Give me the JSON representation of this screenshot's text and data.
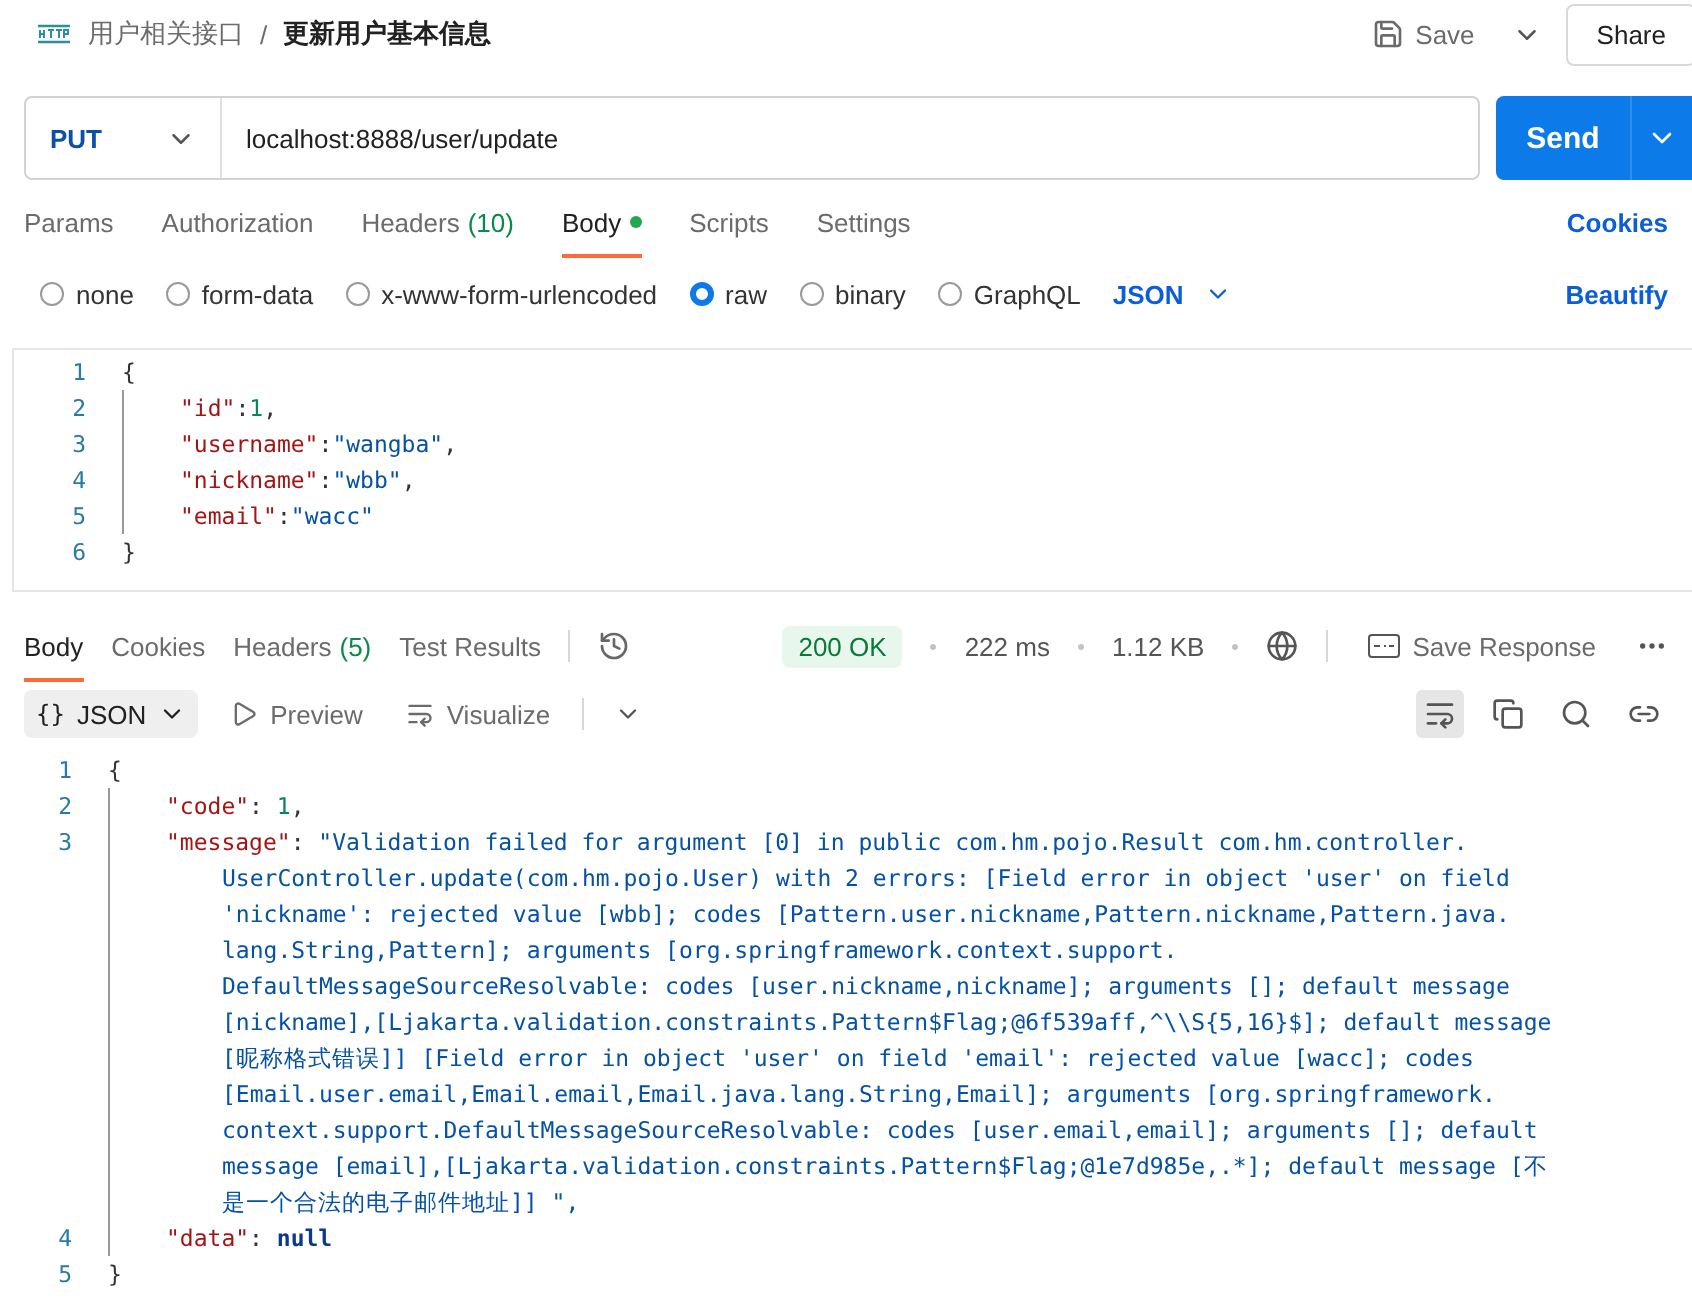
{
  "header": {
    "parent": "用户相关接口",
    "separator": "/",
    "title": "更新用户基本信息",
    "save": "Save",
    "share": "Share"
  },
  "request": {
    "method": "PUT",
    "url": "localhost:8888/user/update",
    "send": "Send"
  },
  "request_tabs": [
    {
      "label": "Params",
      "selected": false
    },
    {
      "label": "Authorization",
      "selected": false
    },
    {
      "label": "Headers",
      "count": "(10)",
      "selected": false
    },
    {
      "label": "Body",
      "selected": true,
      "modified": true
    },
    {
      "label": "Scripts",
      "selected": false
    },
    {
      "label": "Settings",
      "selected": false
    }
  ],
  "cookies_link": "Cookies",
  "body_types": [
    {
      "label": "none",
      "selected": false
    },
    {
      "label": "form-data",
      "selected": false
    },
    {
      "label": "x-www-form-urlencoded",
      "selected": false
    },
    {
      "label": "raw",
      "selected": true
    },
    {
      "label": "binary",
      "selected": false
    },
    {
      "label": "GraphQL",
      "selected": false
    }
  ],
  "body_format": "JSON",
  "beautify": "Beautify",
  "request_body": [
    {
      "number": "1",
      "tokens": [
        {
          "kind": "punct",
          "text": "{"
        }
      ],
      "children": [
        {
          "number": "2",
          "tokens": [
            {
              "kind": "key",
              "text": "\"id\""
            },
            {
              "kind": "punct",
              "text": ":"
            },
            {
              "kind": "num",
              "text": "1"
            },
            {
              "kind": "punct",
              "text": ","
            }
          ]
        },
        {
          "number": "3",
          "tokens": [
            {
              "kind": "key",
              "text": "\"username\""
            },
            {
              "kind": "punct",
              "text": ":"
            },
            {
              "kind": "str",
              "text": "\"wangba\""
            },
            {
              "kind": "punct",
              "text": ","
            }
          ]
        },
        {
          "number": "4",
          "tokens": [
            {
              "kind": "key",
              "text": "\"nickname\""
            },
            {
              "kind": "punct",
              "text": ":"
            },
            {
              "kind": "str",
              "text": "\"wbb\""
            },
            {
              "kind": "punct",
              "text": ","
            }
          ]
        },
        {
          "number": "5",
          "tokens": [
            {
              "kind": "key",
              "text": "\"email\""
            },
            {
              "kind": "punct",
              "text": ":"
            },
            {
              "kind": "str",
              "text": "\"wacc\""
            }
          ]
        }
      ]
    },
    {
      "number": "6",
      "tokens": [
        {
          "kind": "punct",
          "text": "}"
        }
      ]
    }
  ],
  "response_tabs": [
    {
      "label": "Body",
      "selected": true
    },
    {
      "label": "Cookies",
      "selected": false
    },
    {
      "label": "Headers",
      "count": "(5)",
      "selected": false
    },
    {
      "label": "Test Results",
      "selected": false
    }
  ],
  "status": {
    "code": "200 OK",
    "time": "222 ms",
    "size": "1.12 KB",
    "save_response": "Save Response"
  },
  "view": {
    "format_icon": "{}",
    "format": "JSON",
    "preview": "Preview",
    "visualize": "Visualize",
    "wrap_on": true
  },
  "response_body": [
    {
      "number": "1",
      "tokens": [
        {
          "kind": "punct",
          "text": "{"
        }
      ],
      "children": [
        {
          "number": "2",
          "tokens": [
            {
              "kind": "key",
              "text": "\"code\""
            },
            {
              "kind": "punct",
              "text": ": "
            },
            {
              "kind": "num",
              "text": "1"
            },
            {
              "kind": "punct",
              "text": ","
            }
          ]
        },
        {
          "number": "3",
          "tokens": [
            {
              "kind": "key",
              "text": "\"message\""
            },
            {
              "kind": "punct",
              "text": ": "
            },
            {
              "kind": "str",
              "text": "\"Validation failed for argument [0] in public com.hm.pojo.Result com.hm.controller."
            }
          ],
          "wrapped": [
            "UserController.update(com.hm.pojo.User) with 2 errors: [Field error in object 'user' on field",
            "'nickname': rejected value [wbb]; codes [Pattern.user.nickname,Pattern.nickname,Pattern.java.",
            "lang.String,Pattern]; arguments [org.springframework.context.support.",
            "DefaultMessageSourceResolvable: codes [user.nickname,nickname]; arguments []; default message",
            "[nickname],[Ljakarta.validation.constraints.Pattern$Flag;@6f539aff,^\\\\S{5,16}$]; default message",
            "[昵称格式错误]] [Field error in object 'user' on field 'email': rejected value [wacc]; codes",
            "[Email.user.email,Email.email,Email.java.lang.String,Email]; arguments [org.springframework.",
            "context.support.DefaultMessageSourceResolvable: codes [user.email,email]; arguments []; default",
            "message [email],[Ljakarta.validation.constraints.Pattern$Flag;@1e7d985e,.*]; default message [不",
            "是一个合法的电子邮件地址]] \","
          ]
        },
        {
          "number": "4",
          "tokens": [
            {
              "kind": "key",
              "text": "\"data\""
            },
            {
              "kind": "punct",
              "text": ": "
            },
            {
              "kind": "null",
              "text": "null"
            }
          ]
        }
      ]
    },
    {
      "number": "5",
      "tokens": [
        {
          "kind": "punct",
          "text": "}"
        }
      ]
    }
  ]
}
